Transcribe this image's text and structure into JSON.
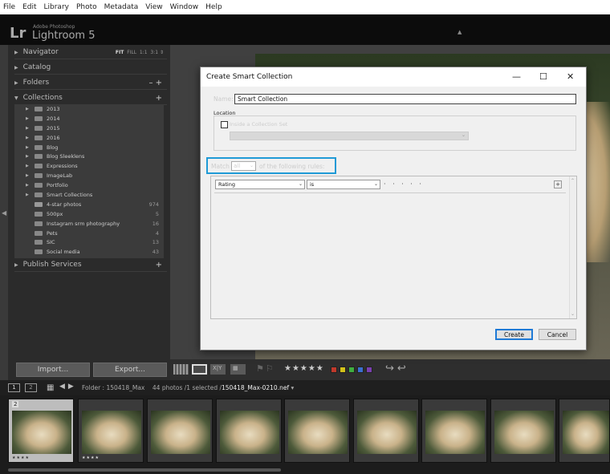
{
  "menu": [
    "File",
    "Edit",
    "Library",
    "Photo",
    "Metadata",
    "View",
    "Window",
    "Help"
  ],
  "app": {
    "logo": "Lr",
    "sub1": "Adobe Photoshop",
    "name": "Lightroom 5"
  },
  "left_panel": {
    "navigator": "Navigator",
    "nav_options": [
      "FIT",
      "FILL",
      "1:1",
      "3:1"
    ],
    "catalog": "Catalog",
    "folders": "Folders",
    "folders_actions": "–  +",
    "collections": "Collections",
    "collections_action": "+",
    "collection_items": [
      {
        "name": "2013",
        "count": ""
      },
      {
        "name": "2014",
        "count": ""
      },
      {
        "name": "2015",
        "count": ""
      },
      {
        "name": "2016",
        "count": ""
      },
      {
        "name": "Blog",
        "count": ""
      },
      {
        "name": "Blog Sleeklens",
        "count": ""
      },
      {
        "name": "Expressions",
        "count": ""
      },
      {
        "name": "ImageLab",
        "count": ""
      },
      {
        "name": "Portfolio",
        "count": ""
      },
      {
        "name": "Smart Collections",
        "count": ""
      },
      {
        "name": "4-star photos",
        "count": "974"
      },
      {
        "name": "500px",
        "count": "5"
      },
      {
        "name": "Instagram srm photography",
        "count": "16"
      },
      {
        "name": "Pets",
        "count": "4"
      },
      {
        "name": "SIC",
        "count": "13"
      },
      {
        "name": "Social media",
        "count": "43"
      }
    ],
    "publish": "Publish Services",
    "publish_action": "+",
    "import_label": "Import...",
    "export_label": "Export..."
  },
  "toolbar": {
    "stars": "★★★★★",
    "colors": [
      "#c0392b",
      "#d4c21a",
      "#3fae3f",
      "#3a6fd0",
      "#7a3fb0"
    ]
  },
  "filmbar": {
    "b1": "1",
    "b2": "2",
    "folder_text": "Folder : 150418_Max",
    "count_text": "44 photos /1 selected /",
    "selected_file": "150418_Max-0210.nef"
  },
  "filmstrip": {
    "selected_number": "2",
    "stars": "★★★★"
  },
  "dialog": {
    "title": "Create Smart Collection",
    "name_label": "Name:",
    "name_value": "Smart Collection",
    "location_label": "Location",
    "inside_label": "Inside a Collection Set",
    "match_label": "Match",
    "match_value": "all",
    "match_rest": "of the following rules:",
    "rule_field": "Rating",
    "rule_op": "is",
    "rule_value": "· · · · ·",
    "rule_add": "+",
    "create_label": "Create",
    "cancel_label": "Cancel"
  }
}
